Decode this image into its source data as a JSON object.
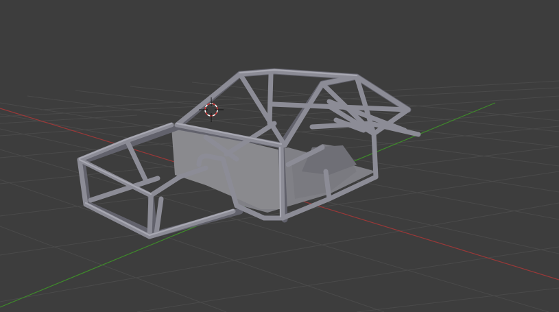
{
  "viewport": {
    "background": "#3d3d3d",
    "grid_color": "#4a4a4a",
    "x_axis_color": "#9a3838",
    "y_axis_color": "#3e8a2a",
    "mesh_color": "#8c8c96",
    "mesh_shadow": "#62626c",
    "panel_color": "#8a8a8e",
    "cursor_color": "#d83a3a"
  },
  "scene": {
    "object": "tube-frame-chassis",
    "cursor": "3d-cursor-icon"
  }
}
